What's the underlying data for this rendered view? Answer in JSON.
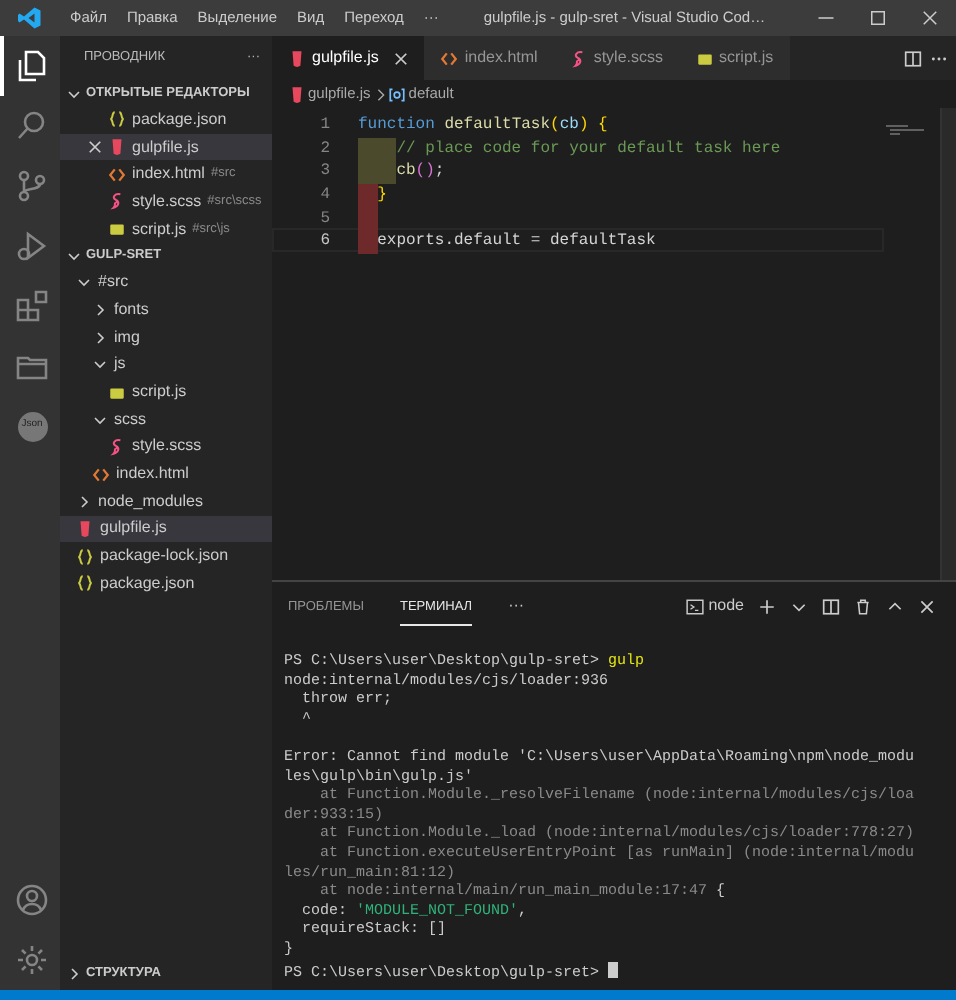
{
  "title_bar": {
    "menu": [
      "Файл",
      "Правка",
      "Выделение",
      "Вид",
      "Переход",
      "···"
    ],
    "title": "gulpfile.js - gulp-sret - Visual Studio Cod…"
  },
  "activity_bar": {
    "items": [
      {
        "kind": "explorer",
        "selected": true
      },
      {
        "kind": "search",
        "selected": false
      },
      {
        "kind": "source-control",
        "selected": false
      },
      {
        "kind": "run",
        "selected": false
      },
      {
        "kind": "extensions",
        "selected": false
      },
      {
        "kind": "folder",
        "selected": false
      },
      {
        "kind": "badge",
        "label": "Json",
        "selected": false
      }
    ],
    "bottom": [
      {
        "kind": "account"
      },
      {
        "kind": "settings"
      }
    ]
  },
  "sidebar": {
    "title": "ПРОВОДНИК",
    "more": "···",
    "open_editors": {
      "label": "ОТКРЫТЫЕ РЕДАКТОРЫ",
      "expanded": true,
      "items": [
        {
          "name": "package.json",
          "kind": "json",
          "selected": false
        },
        {
          "name": "gulpfile.js",
          "kind": "gulp",
          "selected": true
        },
        {
          "name": "index.html",
          "kind": "html",
          "description": "#src",
          "selected": false
        },
        {
          "name": "style.scss",
          "kind": "scss",
          "description": "#src\\scss",
          "selected": false
        },
        {
          "name": "script.js",
          "kind": "js",
          "description": "#src\\js",
          "selected": false
        }
      ]
    },
    "folder": {
      "label": "GULP-SRET",
      "expanded": true,
      "items": [
        {
          "name": "#src",
          "kind": "folder",
          "expanded": true,
          "selected": false,
          "children": [
            {
              "name": "fonts",
              "kind": "folder",
              "expanded": false,
              "selected": false
            },
            {
              "name": "img",
              "kind": "folder",
              "expanded": false,
              "selected": false
            },
            {
              "name": "js",
              "kind": "folder",
              "expanded": true,
              "selected": false,
              "children": [
                {
                  "name": "script.js",
                  "kind": "js",
                  "selected": false
                }
              ]
            },
            {
              "name": "scss",
              "kind": "folder",
              "expanded": true,
              "selected": false,
              "children": [
                {
                  "name": "style.scss",
                  "kind": "scss",
                  "selected": false
                }
              ]
            },
            {
              "name": "index.html",
              "kind": "html",
              "selected": false
            }
          ]
        },
        {
          "name": "node_modules",
          "kind": "folder",
          "expanded": false,
          "selected": false
        },
        {
          "name": "gulpfile.js",
          "kind": "gulp",
          "selected": true
        },
        {
          "name": "package-lock.json",
          "kind": "json",
          "selected": false
        },
        {
          "name": "package.json",
          "kind": "json",
          "selected": false
        }
      ]
    },
    "outline": {
      "label": "СТРУКТУРА",
      "expanded": false
    }
  },
  "tabs": [
    {
      "label": "gulpfile.js",
      "kind": "gulp",
      "selected": true
    },
    {
      "label": "index.html",
      "kind": "html",
      "selected": false
    },
    {
      "label": "style.scss",
      "kind": "scss",
      "selected": false
    },
    {
      "label": "script.js",
      "kind": "js",
      "selected": false
    }
  ],
  "breadcrumb": [
    {
      "label": "gulpfile.js",
      "kind": "gulp"
    },
    {
      "label": "default",
      "kind": "symbol"
    }
  ],
  "code": [
    {
      "number": "1",
      "current": false,
      "tokens": [
        {
          "text": "function",
          "kind": "keyword"
        },
        {
          "text": " defaultTask",
          "kind": "function"
        },
        {
          "text": "(",
          "kind": "bracket"
        },
        {
          "text": "cb",
          "kind": "param"
        },
        {
          "text": ")",
          "kind": "bracket"
        },
        {
          "text": " {",
          "kind": "bracket"
        }
      ]
    },
    {
      "number": "2",
      "current": false,
      "color": "#4b4a2c",
      "tokens": [
        {
          "text": "    // place code for your default task here",
          "kind": "comment"
        }
      ]
    },
    {
      "number": "3",
      "current": false,
      "color": "#4b4a2c",
      "tokens": [
        {
          "text": "    cb",
          "kind": "function"
        },
        {
          "text": "()",
          "kind": "bracket2"
        },
        {
          "text": ";",
          "kind": "plain"
        }
      ]
    },
    {
      "number": "4",
      "current": false,
      "color": "#6e2a2a",
      "tokens": [
        {
          "text": "  }",
          "kind": "bracket"
        }
      ]
    },
    {
      "number": "5",
      "current": false,
      "color": "#6e2a2a"
    },
    {
      "number": "6",
      "current": true,
      "color": "#6e2a2a",
      "tokens": [
        {
          "text": "  exports.default = defaultTask",
          "kind": "plain"
        }
      ]
    }
  ],
  "panel": {
    "tabs": [
      {
        "label": "ПРОБЛЕМЫ",
        "selected": false
      },
      {
        "label": "ТЕРМИНАЛ",
        "selected": true
      }
    ],
    "more": "···",
    "terminal_name": "node",
    "lines": [
      {
        "segments": [
          {
            "text": "PS C:\\Users\\user\\Desktop\\gulp-sret> ",
            "kind": "plain"
          },
          {
            "text": "gulp",
            "kind": "command"
          }
        ]
      },
      {
        "segments": [
          {
            "text": "node:internal/modules/cjs/loader:936",
            "kind": "plain"
          }
        ]
      },
      {
        "segments": [
          {
            "text": "  throw err;",
            "kind": "plain"
          }
        ]
      },
      {
        "segments": [
          {
            "text": "  ^",
            "kind": "plain"
          }
        ]
      },
      {
        "blank_before": true,
        "segments": [
          {
            "text": "Error: Cannot find module 'C:\\Users\\user\\AppData\\Roaming\\npm\\node_modu",
            "kind": "plain"
          }
        ]
      },
      {
        "segments": [
          {
            "text": "les\\gulp\\bin\\gulp.js'",
            "kind": "plain"
          }
        ]
      },
      {
        "segments": [
          {
            "text": "    at Function.Module._resolveFilename (node:internal/modules/cjs/loa",
            "kind": "dim"
          }
        ]
      },
      {
        "segments": [
          {
            "text": "der:933:15)",
            "kind": "dim"
          }
        ]
      },
      {
        "segments": [
          {
            "text": "    at Function.Module._load (node:internal/modules/cjs/loader:778:27)",
            "kind": "dim"
          }
        ]
      },
      {
        "segments": [
          {
            "text": "    at Function.executeUserEntryPoint [as runMain] (node:internal/modu",
            "kind": "dim"
          }
        ]
      },
      {
        "segments": [
          {
            "text": "les/run_main:81:12)",
            "kind": "dim"
          }
        ]
      },
      {
        "segments": [
          {
            "text": "    at node:internal/main/run_main_module:17:47",
            "kind": "dim"
          },
          {
            "text": " {",
            "kind": "plain"
          }
        ]
      },
      {
        "segments": [
          {
            "text": "  code: ",
            "kind": "plain"
          },
          {
            "text": "'MODULE_NOT_FOUND'",
            "kind": "string"
          },
          {
            "text": ",",
            "kind": "plain"
          }
        ]
      },
      {
        "segments": [
          {
            "text": "  requireStack: []",
            "kind": "plain"
          }
        ]
      },
      {
        "segments": [
          {
            "text": "}",
            "kind": "plain"
          }
        ]
      },
      {
        "segments": [
          {
            "text": "PS C:\\Users\\user\\Desktop\\gulp-sret> ",
            "kind": "plain"
          }
        ],
        "cursor": true
      }
    ]
  }
}
